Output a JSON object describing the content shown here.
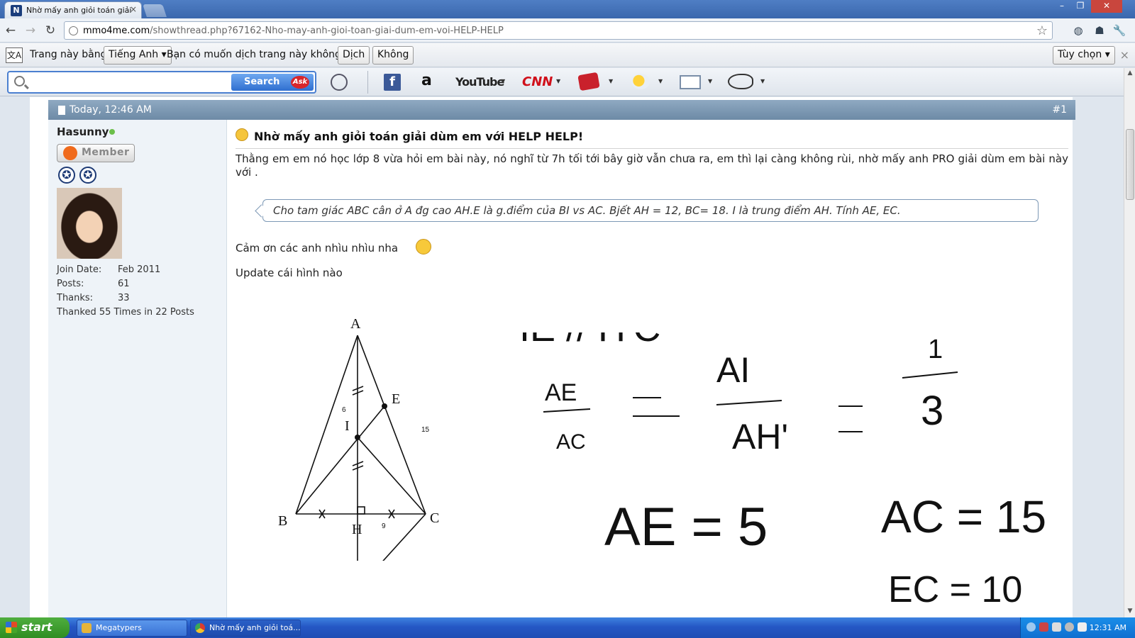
{
  "browser": {
    "tab_title": "Nhờ mấy anh giỏi toán giải dùm",
    "tab_close": "×",
    "url_host": "mmo4me.com",
    "url_path": "/showthread.php?67162-Nho-may-anh-gioi-toan-giai-dum-em-voi-HELP-HELP",
    "window_controls": [
      "–",
      "❐",
      "✕"
    ]
  },
  "translate_bar": {
    "prefix": "Trang này bằng",
    "language": "Tiếng Anh",
    "question": "Bạn có muốn dịch trang này không?",
    "translate_button": "Dịch",
    "no_button": "Không",
    "options_button": "Tùy chọn",
    "close": "×"
  },
  "ask_toolbar": {
    "search_button": "Search",
    "ask_logo": "Ask",
    "items": [
      "facebook-icon",
      "amazon-icon",
      "youtube-icon",
      "cnn-icon",
      "games-icon",
      "weather-icon",
      "mail-icon",
      "sound-icon"
    ],
    "youtube_label": "YouTube",
    "cnn_label": "CNN",
    "amazon_label": "a",
    "facebook_label": "f"
  },
  "post": {
    "date": "Today, 12:46 AM",
    "number": "#1",
    "title": "Nhờ mấy anh giỏi toán giải dùm em với HELP HELP!",
    "body": "Thằng em em nó học lớp 8 vừa hỏi em bài này, nó nghĩ từ 7h tối tới bây giờ vẫn chưa ra, em thì lại càng không rùi, nhờ mấy anh PRO giải dùm em bài này với .",
    "quote": "Cho tam giác ABC cân ở A đg cao AH.E là g.điểm của BI vs AC. Bjết AH = 12, BC= 18. I là trung điểm AH. Tính AE, EC.",
    "thanks": "Cảm ơn các anh nhìu nhìu nha",
    "update": "Update cái hình nào"
  },
  "user": {
    "name": "Hasunny",
    "rank": "Member",
    "stats": [
      {
        "label": "Join Date:",
        "value": "Feb 2011"
      },
      {
        "label": "Posts:",
        "value": "61"
      },
      {
        "label": "Thanks:",
        "value": "33"
      }
    ],
    "thanked": "Thanked 55 Times in 22 Posts"
  },
  "figure": {
    "labels": {
      "A": "A",
      "B": "B",
      "C": "C",
      "H": "H",
      "I": "I",
      "E": "E"
    },
    "numbers": {
      "six": "6",
      "fifteen": "15",
      "nine": "9"
    }
  },
  "handwriting": {
    "line1": "IE // H'C",
    "line2_left": "AE",
    "line2_left_den": "AC",
    "line2_mid_num": "AI",
    "line2_mid_den": "AH'",
    "line2_right_num": "1",
    "line2_right_den": "3",
    "ae": "AE = 5",
    "ac": "AC = 15",
    "ec": "EC = 10"
  },
  "taskbar": {
    "start": "start",
    "tasks": [
      "Megatypers",
      "Nhờ mấy anh giỏi toá..."
    ],
    "clock": "12:31 AM"
  }
}
